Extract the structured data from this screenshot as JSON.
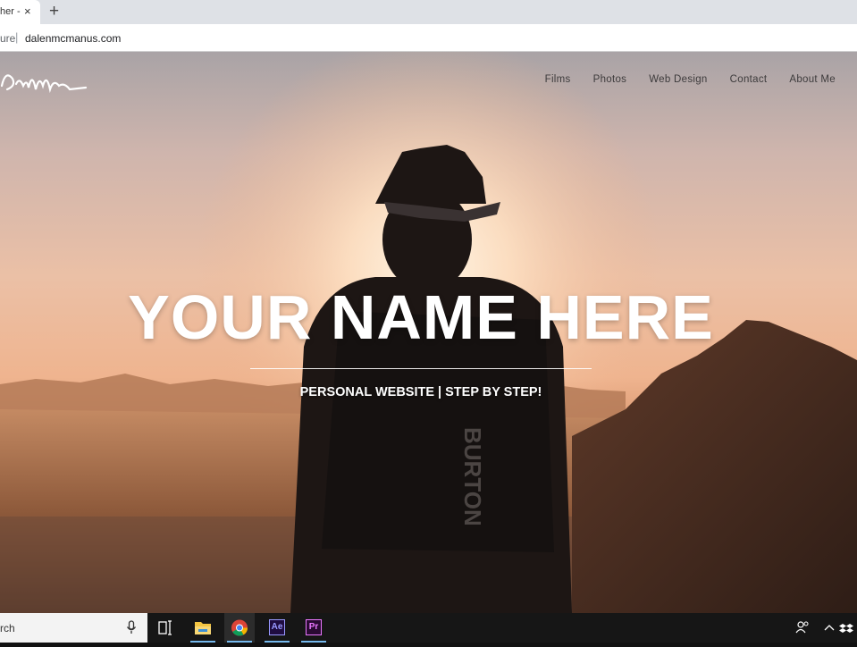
{
  "browser": {
    "tab_title": "her -",
    "tab_close": "×",
    "new_tab": "+",
    "secure_label": "ure",
    "url": "dalenmcmanus.com"
  },
  "site": {
    "nav": [
      "Films",
      "Photos",
      "Web Design",
      "Contact",
      "About Me"
    ],
    "hero_title": "YOUR NAME HERE",
    "hero_subtitle": "PERSONAL WEBSITE | STEP BY STEP!"
  },
  "taskbar": {
    "search_placeholder": "rch",
    "ae_label": "Ae",
    "pr_label": "Pr"
  },
  "icons": [
    "close-icon",
    "plus-icon",
    "signature-logo",
    "microphone-icon",
    "task-view-icon",
    "file-explorer-icon",
    "chrome-icon",
    "after-effects-icon",
    "premiere-pro-icon",
    "people-icon",
    "chevron-up-icon",
    "dropbox-icon"
  ],
  "colors": {
    "taskbar_bg": "#161616",
    "nav_text": "#3d3b3c",
    "ae_color": "#9999ff",
    "pr_color": "#ea77ff",
    "active_indicator": "#76b9ed"
  }
}
